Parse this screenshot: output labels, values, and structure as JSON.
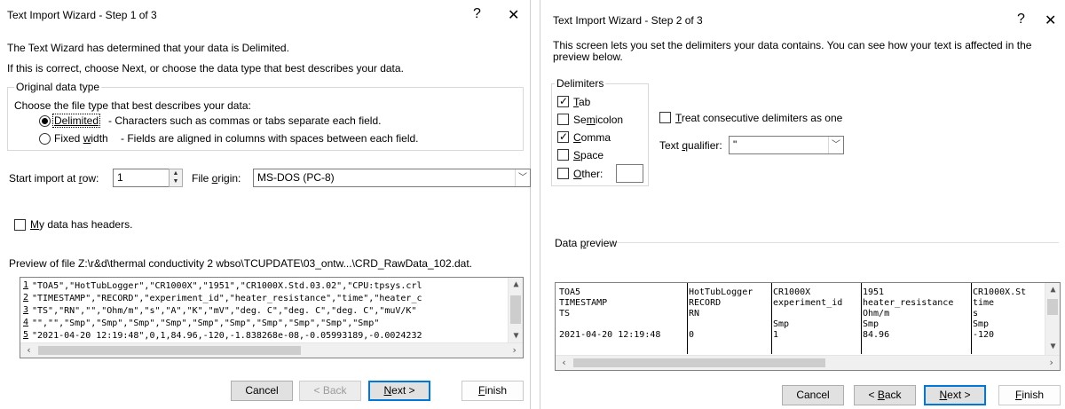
{
  "step1": {
    "title": "Text Import Wizard - Step 1 of 3",
    "help_glyph": "?",
    "close_glyph": "✕",
    "intro1": "The Text Wizard has determined that your data is Delimited.",
    "intro2": "If this is correct, choose Next, or choose the data type that best describes your data.",
    "group_label": "Original data type",
    "choose_label": "Choose the file type that best describes your data:",
    "delimited_label": "Delimited",
    "delimited_desc": "- Characters such as commas or tabs separate each field.",
    "fixed_label_pre": "Fixed ",
    "fixed_label_u": "w",
    "fixed_label_post": "idth",
    "fixed_desc": "- Fields are aligned in columns with spaces between each field.",
    "start_row_label_pre": "Start import at ",
    "start_row_label_u": "r",
    "start_row_label_post": "ow:",
    "start_row_value": "1",
    "file_origin_label_pre": "File ",
    "file_origin_label_u": "o",
    "file_origin_label_post": "rigin:",
    "file_origin_value": "MS-DOS (PC-8)",
    "headers_label_u": "M",
    "headers_label_post": "y data has headers.",
    "preview_label": "Preview of file Z:\\r&d\\thermal conductivity 2 wbso\\TCUPDATE\\03_ontw...\\CRD_RawData_102.dat.",
    "preview_lines": [
      {
        "n": "1",
        "text": "\"TOA5\",\"HotTubLogger\",\"CR1000X\",\"1951\",\"CR1000X.Std.03.02\",\"CPU:tpsys.crl"
      },
      {
        "n": "2",
        "text": "\"TIMESTAMP\",\"RECORD\",\"experiment_id\",\"heater_resistance\",\"time\",\"heater_c"
      },
      {
        "n": "3",
        "text": "\"TS\",\"RN\",\"\",\"Ohm/m\",\"s\",\"A\",\"K\",\"mV\",\"deg. C\",\"deg. C\",\"deg. C\",\"muV/K\""
      },
      {
        "n": "4",
        "text": "\"\",\"\",\"Smp\",\"Smp\",\"Smp\",\"Smp\",\"Smp\",\"Smp\",\"Smp\",\"Smp\",\"Smp\",\"Smp\""
      },
      {
        "n": "5",
        "text": "\"2021-04-20 12:19:48\",0,1,84.96,-120,-1.838268e-08,-0.05993189,-0.0024232"
      }
    ],
    "cancel": "Cancel",
    "back": "< Back",
    "next_u": "N",
    "next_post": "ext >",
    "finish_u": "F",
    "finish_post": "inish"
  },
  "step2": {
    "title": "Text Import Wizard - Step 2 of 3",
    "help_glyph": "?",
    "close_glyph": "✕",
    "intro": "This screen lets you set the delimiters your data contains.  You can see how your text is affected in the preview below.",
    "delimiters_label": "Delimiters",
    "tab_u": "T",
    "tab_post": "ab",
    "semicolon_pre": "Se",
    "semicolon_u": "m",
    "semicolon_post": "icolon",
    "comma_u": "C",
    "comma_post": "omma",
    "space_u": "S",
    "space_post": "pace",
    "other_u": "O",
    "other_post": "ther:",
    "consecutive_u": "T",
    "consecutive_post": "reat consecutive delimiters as one",
    "qualifier_label_pre": "Text ",
    "qualifier_label_u": "q",
    "qualifier_label_post": "ualifier:",
    "qualifier_value": "\"",
    "data_preview_label_pre": "Data ",
    "data_preview_label_u": "p",
    "data_preview_label_post": "review",
    "columns": [
      [
        "TOA5",
        "TIMESTAMP",
        "TS",
        "",
        "2021-04-20 12:19:48"
      ],
      [
        "HotTubLogger",
        "RECORD",
        "RN",
        "",
        "0"
      ],
      [
        "CR1000X",
        "experiment_id",
        "",
        "Smp",
        "1"
      ],
      [
        "1951",
        "heater_resistance",
        "Ohm/m",
        "Smp",
        "84.96"
      ],
      [
        "CR1000X.St",
        "time",
        "s",
        "Smp",
        "-120"
      ]
    ],
    "cancel": "Cancel",
    "back_pre": "< ",
    "back_u": "B",
    "back_post": "ack",
    "next_u": "N",
    "next_post": "ext >",
    "finish_u": "F",
    "finish_post": "inish"
  }
}
